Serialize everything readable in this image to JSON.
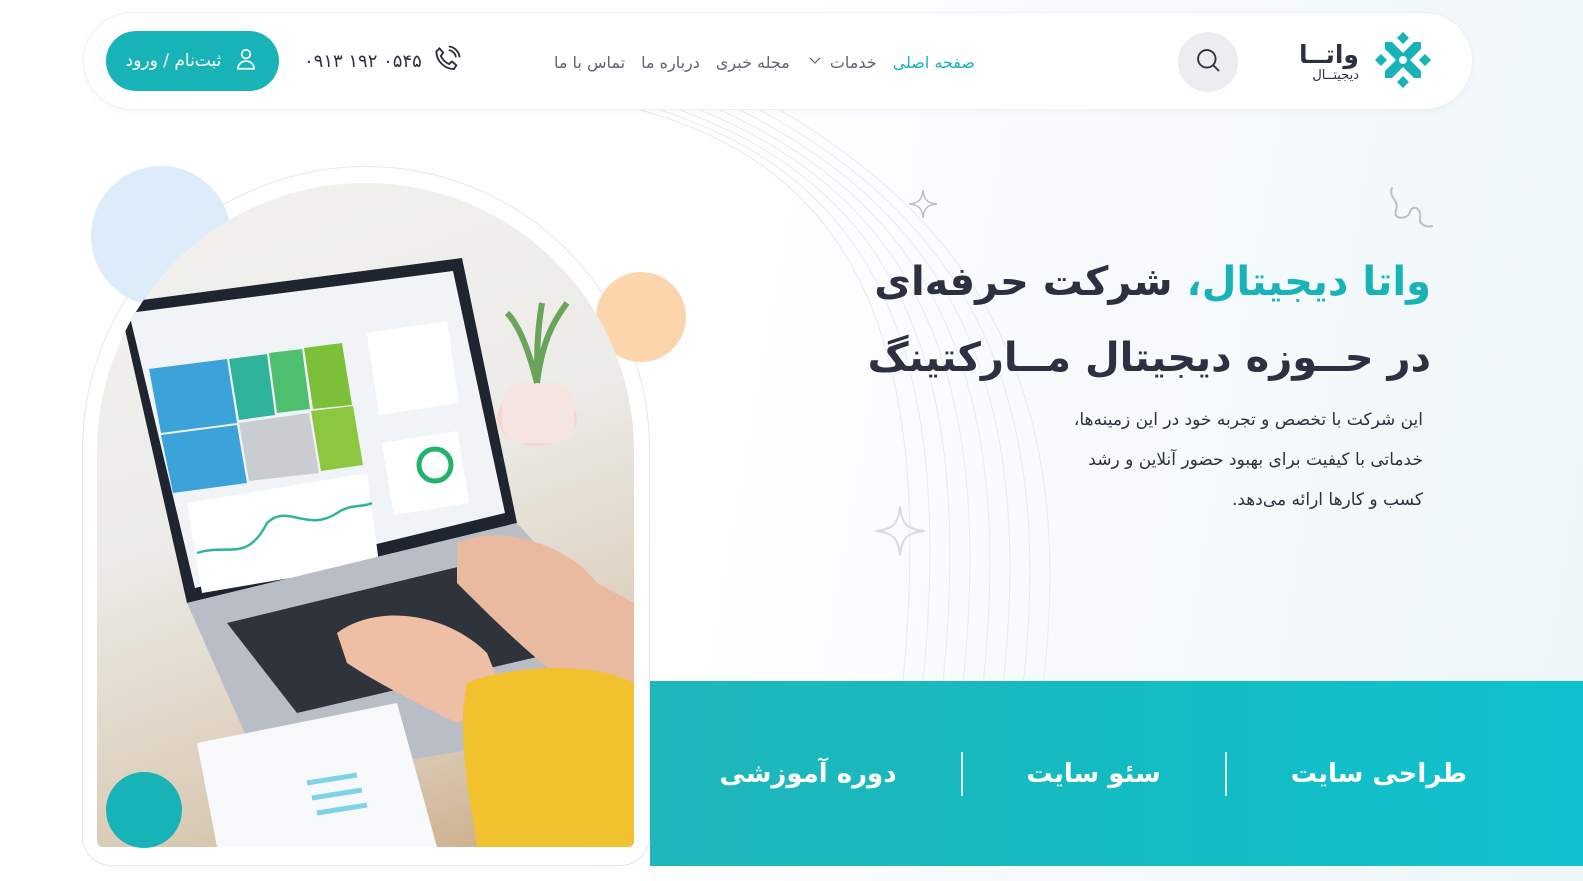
{
  "header": {
    "logo_main": "واتــا",
    "logo_sub": "دیجیتــال",
    "login_label": "ثبت‌نام / ورود",
    "phone": "۰۹۱۳ ۱۹۲ ۰۵۴۵",
    "nav": [
      {
        "label": "صفحه اصلی",
        "active": true
      },
      {
        "label": "خدمات",
        "has_dropdown": true
      },
      {
        "label": "مجله خبری"
      },
      {
        "label": "درباره ما"
      },
      {
        "label": "تماس با ما"
      }
    ],
    "icons": {
      "search": "search-icon",
      "phone": "phone-icon",
      "user": "user-icon"
    }
  },
  "hero": {
    "title_accent": "واتا دیجیتال،",
    "title_rest_line1": " شرکت حرفه‌ای",
    "title_line2": "در حــوزه دیجیتال مــارکتینگ",
    "desc_line1": "این شرکت با تخصص و تجربه خود در این زمینه‌ها،",
    "desc_line2": "خدماتی با کیفیت برای بهبود حضور آنلاین و رشد",
    "desc_line3": "کسب و کارها ارائه می‌دهد."
  },
  "services": [
    {
      "label": "طراحی سایت"
    },
    {
      "label": "سئو سایت"
    },
    {
      "label": "دوره آموزشی"
    }
  ],
  "colors": {
    "accent": "#17b3b6",
    "text": "#2b3140",
    "muted": "#5f6572",
    "blob_blue": "#dcecfb",
    "blob_orange": "#fcd5ac"
  }
}
